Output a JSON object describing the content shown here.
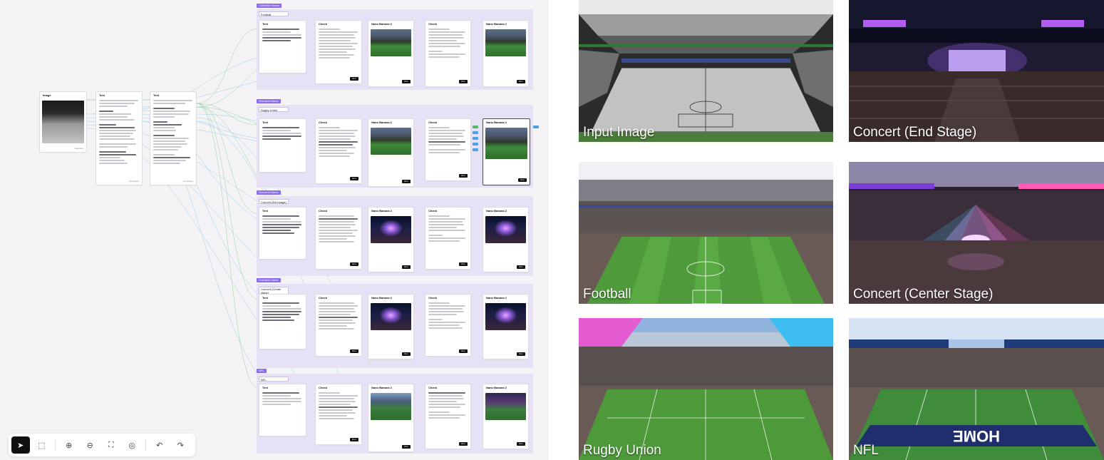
{
  "canvas": {
    "source_nodes": [
      {
        "header": "Image",
        "footer": "Required"
      },
      {
        "header": "Text",
        "footer": "Generated"
      },
      {
        "header": "Text",
        "footer": "Generated"
      }
    ],
    "groups": [
      {
        "tag": "Collection Name",
        "input": "Football",
        "check_header": "Check",
        "result_header": "Nano Banana 2",
        "recheck_header": "Check",
        "final_header": "Nano Banana 2"
      },
      {
        "tag": "Scenario Name",
        "input": "Rugby Union",
        "check_header": "Check",
        "result_header": "Nano Banana 2",
        "recheck_header": "Check",
        "final_header": "Nano Banana 2"
      },
      {
        "tag": "Scenario Name",
        "input": "Concert (End stage)",
        "check_header": "Check",
        "result_header": "Nano Banana 2",
        "recheck_header": "Check",
        "final_header": "Nano Banana 2"
      },
      {
        "tag": "Scenario Name",
        "input": "Concert (Center stage)",
        "check_header": "Check",
        "result_header": "Nano Banana 2",
        "recheck_header": "Check",
        "final_header": "Nano Banana 2"
      },
      {
        "tag": "NFL",
        "input": "NFL",
        "check_header": "Check",
        "result_header": "Nano Banana 2",
        "recheck_header": "Check",
        "final_header": "Nano Banana 2"
      }
    ],
    "text_node_header": "Text",
    "run_label": "Run",
    "toolbar": [
      {
        "icon": "pointer-icon",
        "glyph": "➤"
      },
      {
        "icon": "frame-select-icon",
        "glyph": "⬚"
      },
      {
        "icon": "zoom-in-icon",
        "glyph": "⊕"
      },
      {
        "icon": "zoom-out-icon",
        "glyph": "⊖"
      },
      {
        "icon": "fit-view-icon",
        "glyph": "⛶"
      },
      {
        "icon": "focus-icon",
        "glyph": "◎"
      },
      {
        "icon": "undo-icon",
        "glyph": "↶"
      },
      {
        "icon": "redo-icon",
        "glyph": "↷"
      }
    ]
  },
  "gallery": {
    "tiles": [
      {
        "caption": "Input Image",
        "scene": "input"
      },
      {
        "caption": "Concert (End Stage)",
        "scene": "concert-end"
      },
      {
        "caption": "Football",
        "scene": "football"
      },
      {
        "caption": "Concert (Center Stage)",
        "scene": "concert-center"
      },
      {
        "caption": "Rugby Union",
        "scene": "rugby"
      },
      {
        "caption": "NFL",
        "scene": "nfl"
      }
    ],
    "nfl_endzone_text": "HOME"
  },
  "colors": {
    "group_bg": "#e6e1f5",
    "group_tag": "#8b6cf0",
    "wire_green": "#7cc48a",
    "wire_blue": "#8cc3e6",
    "toolbar_active": "#111111"
  }
}
